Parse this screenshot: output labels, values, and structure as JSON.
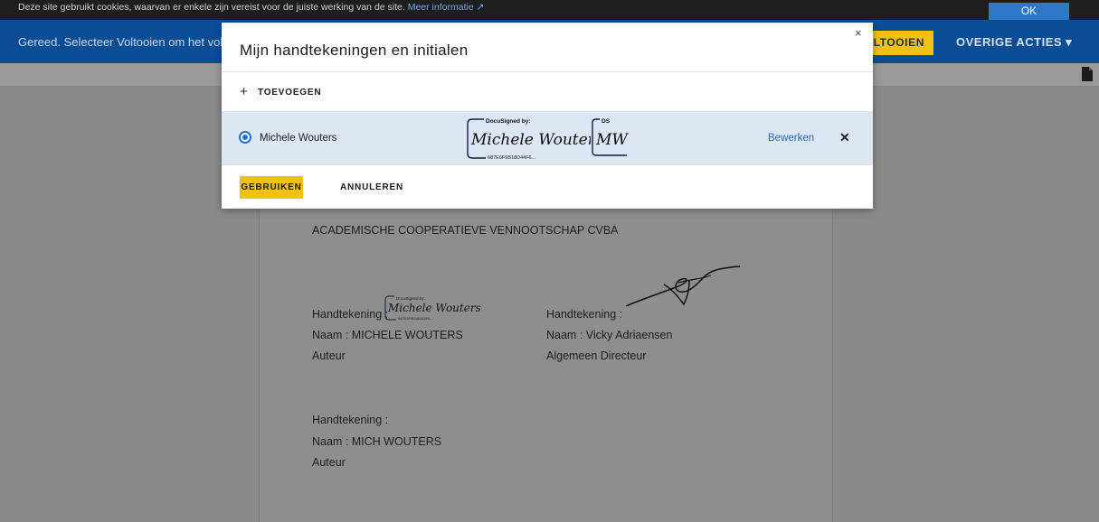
{
  "cookie_bar": {
    "text": "Deze site gebruikt cookies, waarvan er enkele zijn vereist voor de juiste werking van de site.",
    "more_info": "Meer informatie",
    "ok_label": "OK"
  },
  "header": {
    "status": "Gereed. Selecteer Voltooien om het voltoo",
    "finish_label": "LTOOIEN",
    "other_actions": "OVERIGE ACTIES ▾"
  },
  "document": {
    "company": "ACADEMISCHE COOPERATIEVE VENNOOTSCHAP CVBA",
    "signer1": {
      "sig_label": "Handtekening :",
      "name": "Naam : MICHELE WOUTERS",
      "role": "Auteur",
      "docusigned_by": "DocuSigned by:",
      "signature": "Michele Wouters",
      "hash": "687E6F9B18D44F6..."
    },
    "signer2": {
      "sig_label": "Handtekening :",
      "name": "Naam : Vicky Adriaensen",
      "role": "Algemeen Directeur"
    },
    "signer3": {
      "sig_label": "Handtekening :",
      "name": "Naam : MICH WOUTERS",
      "role": "Auteur"
    }
  },
  "modal": {
    "title": "Mijn handtekeningen en initialen",
    "close": "×",
    "add_label": "TOEVOEGEN",
    "add_icon": "+",
    "owner": "Michele Wouters",
    "docusigned_by": "DocuSigned by:",
    "signature": "Michele Wouters",
    "hash": "687E6F9B18D44F6...",
    "initials_tag": "DS",
    "initials": "MW",
    "edit_label": "Bewerken",
    "remove": "✕",
    "use_label": "GEBRUIKEN",
    "cancel_label": "ANNULEREN"
  },
  "colors": {
    "header_bg": "#0a4d96",
    "accent_yellow": "#f4c014",
    "link_blue": "#2c6ab6",
    "selected_row": "#dde7f4"
  }
}
